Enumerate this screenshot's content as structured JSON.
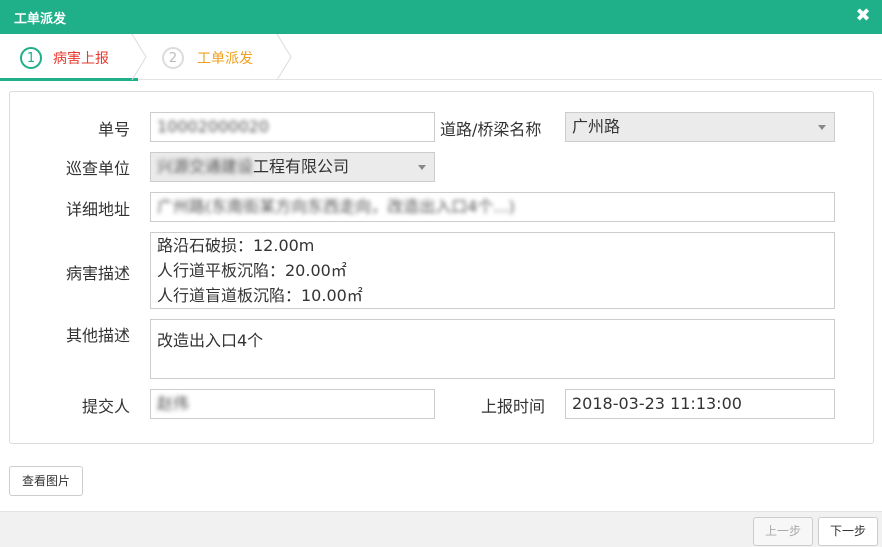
{
  "dialog": {
    "title": "工单派发"
  },
  "steps": [
    {
      "num": "1",
      "label": "病害上报"
    },
    {
      "num": "2",
      "label": "工单派发"
    }
  ],
  "form": {
    "order_no": {
      "label": "单号",
      "value": "10002000020"
    },
    "road_name": {
      "label": "道路/桥梁名称",
      "value": "广州路"
    },
    "patrol_unit": {
      "label": "巡查单位",
      "value_hidden": "兴源交通建设",
      "value": "工程有限公司"
    },
    "address": {
      "label": "详细地址",
      "value": "广州路(东南街某方向东西走向，改造出入口4个...)"
    },
    "disease_desc": {
      "label": "病害描述",
      "lines": [
        "路沿石破损：12.00m",
        "人行道平板沉陷：20.00㎡",
        "人行道盲道板沉陷：10.00㎡"
      ]
    },
    "other_desc": {
      "label": "其他描述",
      "value": "改造出入口4个"
    },
    "submitter": {
      "label": "提交人",
      "value": "赵伟"
    },
    "report_time": {
      "label": "上报时间",
      "value": "2018-03-23 11:13:00"
    }
  },
  "buttons": {
    "view_images": "查看图片",
    "prev": "上一步",
    "next": "下一步"
  },
  "icons": {
    "close": "close-icon"
  },
  "colors": {
    "accent": "#1fb08a",
    "step_active_text": "#e8392f",
    "step_next_text": "#f0a020"
  }
}
